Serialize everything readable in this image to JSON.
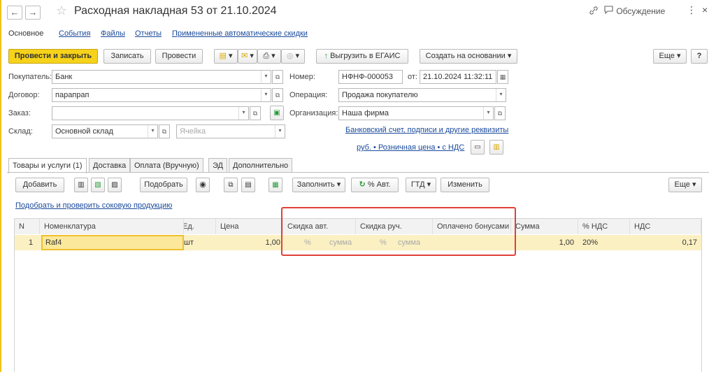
{
  "window": {
    "title": "Расходная накладная 53 от 21.10.2024",
    "discussion_label": "Обсуждение",
    "more_symbol": "⋮",
    "close_symbol": "×",
    "back_symbol": "←",
    "forward_symbol": "→",
    "star_symbol": "☆",
    "link_symbol": "🔗",
    "chat_symbol": "🗨"
  },
  "form_tabs": [
    "Основное",
    "События",
    "Файлы",
    "Отчеты",
    "Примененные автоматические скидки"
  ],
  "toolbar": {
    "post_close": "Провести и закрыть",
    "save": "Записать",
    "post": "Провести",
    "upload_egais": "Выгрузить в ЕГАИС",
    "create_based": "Создать на основании",
    "more": "Еще",
    "help": "?"
  },
  "header": {
    "buyer_label": "Покупатель:",
    "buyer_value": "Банк",
    "contract_label": "Договор:",
    "contract_value": "парапрап",
    "order_label": "Заказ:",
    "order_value": "",
    "warehouse_label": "Склад:",
    "warehouse_value": "Основной склад",
    "cell_placeholder": "Ячейка",
    "number_label": "Номер:",
    "number_value": "НФНФ-000053",
    "from_label": "от:",
    "date_value": "21.10.2024 11:32:11",
    "operation_label": "Операция:",
    "operation_value": "Продажа покупателю",
    "org_label": "Организация:",
    "org_value": "Наша фирма",
    "bank_link": "Банковский счет, подписи и другие реквизиты",
    "price_link": "руб. • Розничная цена • с НДС"
  },
  "detail_tabs": [
    "Товары и услуги (1)",
    "Доставка",
    "Оплата (Вручную)",
    "ЭД",
    "Дополнительно"
  ],
  "table_toolbar": {
    "add": "Добавить",
    "pick": "Подобрать",
    "fill": "Заполнить",
    "auto_pct": "% Авт.",
    "gtd": "ГТД",
    "change": "Изменить",
    "more": "Еще"
  },
  "juice_link": "Подобрать и проверить соковую продукцию",
  "table": {
    "columns": [
      "N",
      "Номенклатура",
      "Ед.",
      "Цена",
      "Скидка авт.",
      "Скидка руч.",
      "Оплачено бонусами",
      "Сумма",
      "% НДС",
      "НДС"
    ],
    "rows": [
      {
        "n": "1",
        "item": "Raf4",
        "unit": "шт",
        "price": "1,00",
        "auto_pct": "%",
        "auto_sum": "сумма",
        "man_pct": "%",
        "man_sum": "сумма",
        "bonus": "",
        "sum": "1,00",
        "vat_rate": "20%",
        "vat": "0,17"
      }
    ]
  },
  "colors": {
    "accent_yellow": "#f6d21a",
    "link_blue": "#1a4a9c",
    "highlight_red": "#e0403a",
    "selected_row": "#fbf0c2"
  }
}
